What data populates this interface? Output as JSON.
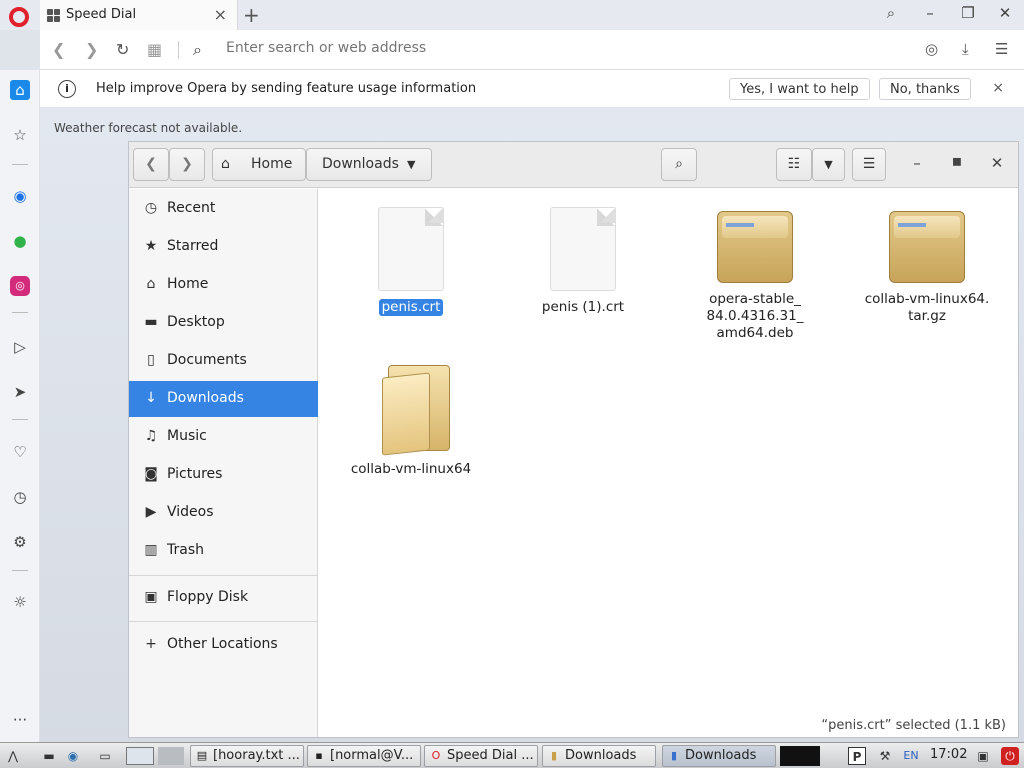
{
  "browser": {
    "tab_title": "Speed Dial",
    "tab_close": "×",
    "new_tab": "+",
    "search_placeholder": "Enter search or web address",
    "notice_text": "Help improve Opera by sending feature usage information",
    "notice_yes": "Yes, I want to help",
    "notice_no": "No, thanks",
    "notice_close": "×",
    "weather": "Weather forecast not available."
  },
  "files": {
    "breadcrumb": [
      "Home",
      "Downloads"
    ],
    "sidebar": [
      {
        "label": "Recent",
        "icon": "clock-icon"
      },
      {
        "label": "Starred",
        "icon": "star-icon"
      },
      {
        "label": "Home",
        "icon": "home-icon"
      },
      {
        "label": "Desktop",
        "icon": "folder-icon"
      },
      {
        "label": "Documents",
        "icon": "document-icon"
      },
      {
        "label": "Downloads",
        "icon": "download-icon"
      },
      {
        "label": "Music",
        "icon": "music-icon"
      },
      {
        "label": "Pictures",
        "icon": "camera-icon"
      },
      {
        "label": "Videos",
        "icon": "video-icon"
      },
      {
        "label": "Trash",
        "icon": "trash-icon"
      }
    ],
    "devices": [
      {
        "label": "Floppy Disk",
        "icon": "floppy-icon"
      }
    ],
    "other": {
      "label": "Other Locations",
      "icon": "plus-icon"
    },
    "items": [
      {
        "name": "penis.crt",
        "kind": "document",
        "selected": true
      },
      {
        "name": "penis (1).crt",
        "kind": "document",
        "selected": false
      },
      {
        "name": "opera-stable_\n84.0.4316.31_\namd64.deb",
        "kind": "archive",
        "selected": false
      },
      {
        "name": "collab-vm-linux64.\ntar.gz",
        "kind": "archive",
        "selected": false
      },
      {
        "name": "collab-vm-linux64",
        "kind": "folder",
        "selected": false
      }
    ],
    "status": "“penis.crt” selected (1.1 kB)"
  },
  "taskbar": {
    "tasks": [
      "[hooray.txt ...",
      "[normal@V...",
      "Speed Dial ...",
      "Downloads",
      "Downloads"
    ],
    "lang": "EN",
    "clock": "17:02"
  }
}
